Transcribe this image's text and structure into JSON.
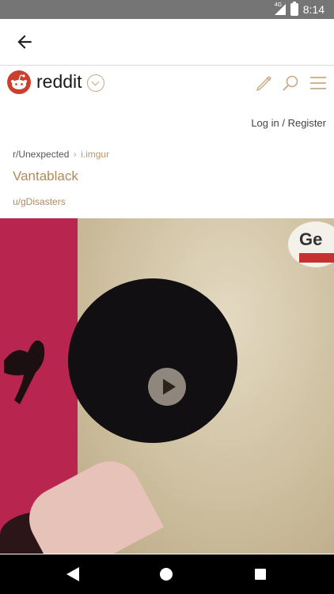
{
  "status_bar": {
    "network": "4G",
    "time": "8:14"
  },
  "header": {
    "wordmark": "reddit"
  },
  "auth": {
    "login": "Log in",
    "separator": " / ",
    "register": "Register"
  },
  "post": {
    "subreddit": "r/Unexpected",
    "domain_separator": "›",
    "domain": "i.imgur",
    "title": "Vantablack",
    "author": "u/gDisasters"
  },
  "media": {
    "sticker_text": "Ge"
  },
  "icons": {
    "back": "back-arrow-icon",
    "pencil": "pencil-icon",
    "search": "search-icon",
    "menu": "hamburger-menu-icon",
    "play": "play-icon"
  },
  "colors": {
    "accent": "#b08a5a",
    "reddit_red": "#cc3f2f",
    "statusbar": "#757575"
  }
}
